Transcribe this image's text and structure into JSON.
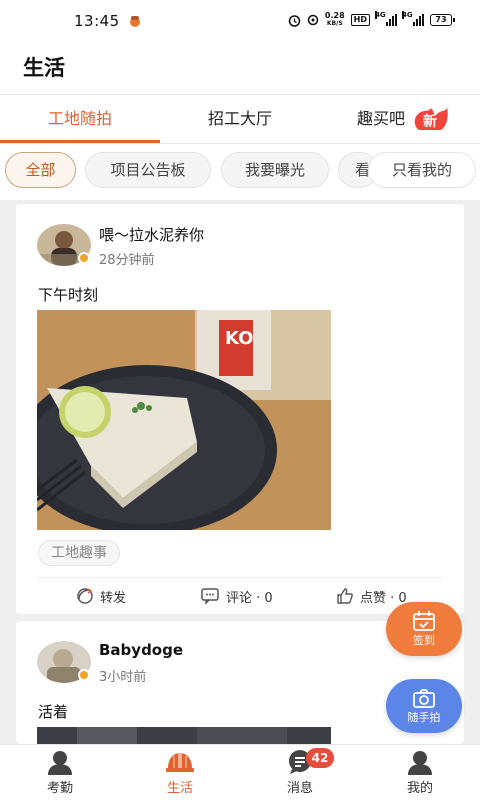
{
  "status_bar": {
    "time": "13:45",
    "net_speed_value": "0.28",
    "net_speed_unit": "KB/S",
    "hd_label": "HD",
    "sim1_label": "4G",
    "sim2_label": "4G",
    "battery": "73"
  },
  "header": {
    "title": "生活"
  },
  "main_tabs": [
    {
      "label": "工地随拍",
      "active": true
    },
    {
      "label": "招工大厅",
      "active": false
    },
    {
      "label": "趣买吧",
      "active": false,
      "badge": "新"
    }
  ],
  "filters": [
    {
      "label": "全部",
      "active": true
    },
    {
      "label": "项目公告板",
      "active": false
    },
    {
      "label": "我要曝光",
      "active": false
    },
    {
      "label": "看",
      "active": false
    },
    {
      "label": "只看我的",
      "active": false
    }
  ],
  "posts": [
    {
      "username": "喂～拉水泥养你",
      "time": "28分钟前",
      "text": "下午时刻",
      "image_caption": "KO",
      "tag": "工地趣事",
      "actions": {
        "share": "转发",
        "comment": "评论 · 0",
        "like": "点赞 · 0"
      }
    },
    {
      "username": "Babydoge",
      "time": "3小时前",
      "text": "活着"
    }
  ],
  "fabs": {
    "checkin": "签到",
    "snap": "随手拍"
  },
  "bottom_nav": [
    {
      "label": "考勤",
      "icon": "user-icon",
      "active": false
    },
    {
      "label": "生活",
      "icon": "helmet-icon",
      "active": true
    },
    {
      "label": "消息",
      "icon": "message-icon",
      "active": false,
      "badge": "42"
    },
    {
      "label": "我的",
      "icon": "profile-icon",
      "active": false
    }
  ],
  "colors": {
    "accent": "#e0622e",
    "checkin_fab": "#ef7b3d",
    "snap_fab": "#5b86e8",
    "badge": "#e94b3c"
  }
}
